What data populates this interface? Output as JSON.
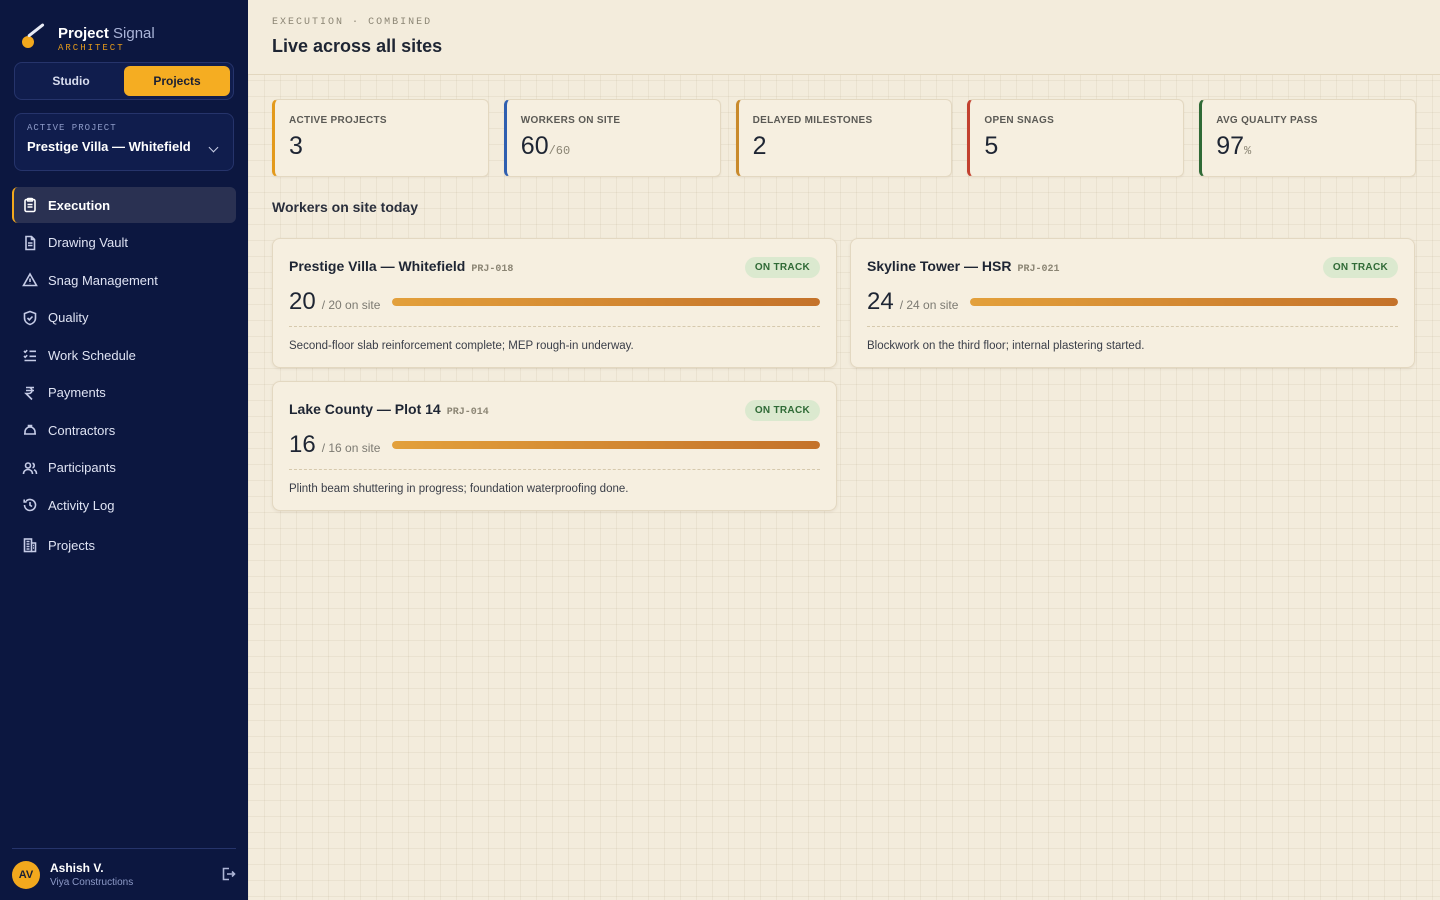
{
  "brand": {
    "name_bold": "Project",
    "name_light": "Signal",
    "role": "ARCHITECT"
  },
  "mode_switch": {
    "studio": "Studio",
    "projects": "Projects"
  },
  "project_picker": {
    "label": "ACTIVE PROJECT",
    "value": "Prestige Villa — Whitefield"
  },
  "nav": {
    "items": [
      {
        "label": "Execution"
      },
      {
        "label": "Drawing Vault"
      },
      {
        "label": "Snag Management"
      },
      {
        "label": "Quality"
      },
      {
        "label": "Work Schedule"
      },
      {
        "label": "Payments"
      },
      {
        "label": "Contractors"
      },
      {
        "label": "Participants"
      },
      {
        "label": "Activity Log"
      },
      {
        "label": "Projects"
      }
    ]
  },
  "user": {
    "initials": "AV",
    "name": "Ashish V.",
    "org": "Viya Constructions"
  },
  "header": {
    "crumb_1": "EXECUTION",
    "crumb_sep": "·",
    "crumb_2": "COMBINED",
    "title": "Live across all sites"
  },
  "stats": [
    {
      "label": "ACTIVE PROJECTS",
      "value": "3",
      "suffix": "",
      "color": "#e39a1c"
    },
    {
      "label": "WORKERS ON SITE",
      "value": "60",
      "suffix": "/60",
      "color": "#2f5fb0"
    },
    {
      "label": "DELAYED MILESTONES",
      "value": "2",
      "suffix": "",
      "color": "#c98a2b"
    },
    {
      "label": "OPEN SNAGS",
      "value": "5",
      "suffix": "",
      "color": "#c2412f"
    },
    {
      "label": "AVG QUALITY PASS",
      "value": "97",
      "suffix": "%",
      "color": "#2f6a36"
    }
  ],
  "section": {
    "title": "Workers on site today"
  },
  "sites": [
    {
      "name": "Prestige Villa — Whitefield",
      "code": "PRJ-018",
      "status": "ON TRACK",
      "count": "20",
      "sub": "/ 20 on site",
      "fill": 1.0,
      "note": "Second-floor slab reinforcement complete; MEP rough-in underway."
    },
    {
      "name": "Skyline Tower — HSR",
      "code": "PRJ-021",
      "status": "ON TRACK",
      "count": "24",
      "sub": "/ 24 on site",
      "fill": 1.0,
      "note": "Blockwork on the third floor; internal plastering started."
    },
    {
      "name": "Lake County — Plot 14",
      "code": "PRJ-014",
      "status": "ON TRACK",
      "count": "16",
      "sub": "/ 16 on site",
      "fill": 1.0,
      "note": "Plinth beam shuttering in progress; foundation waterproofing done."
    }
  ]
}
